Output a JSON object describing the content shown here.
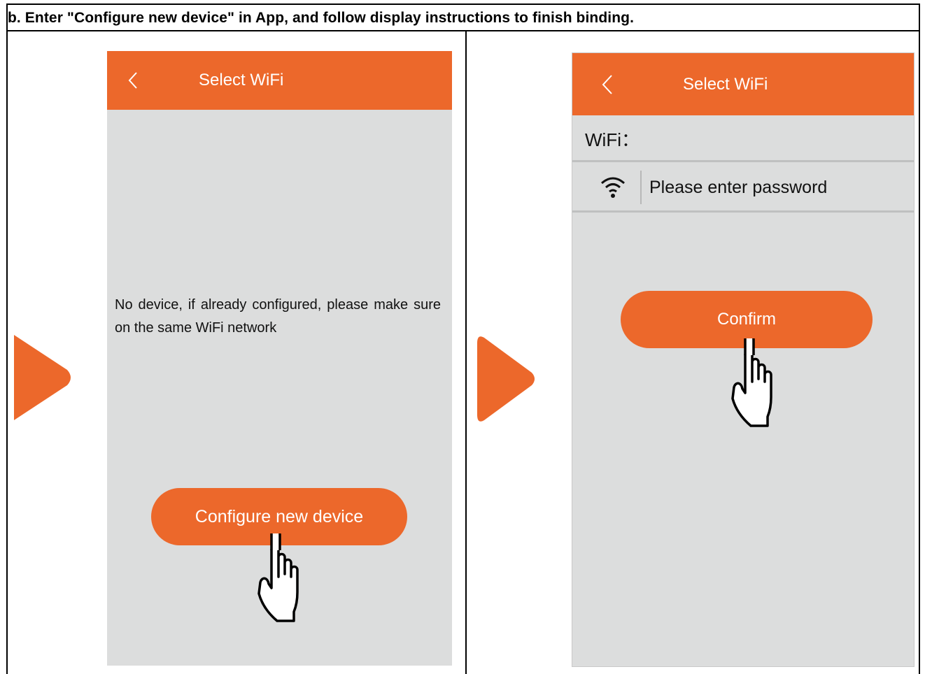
{
  "instruction": "b. Enter \"Configure new device\" in App, and follow display instructions to finish binding.",
  "colors": {
    "accent": "#ec682b",
    "screen_bg": "#dcdddd"
  },
  "screen1": {
    "back_icon": "chevron-left-icon",
    "title": "Select WiFi",
    "message": "No device, if already configured, please make sure on the same WiFi network",
    "configure_button": "Configure new device",
    "pointer_icon": "pointing-hand-icon"
  },
  "screen2": {
    "back_icon": "chevron-left-icon",
    "title": "Select WiFi",
    "wifi_label": "WiFi：",
    "wifi_icon": "wifi-icon",
    "password_placeholder": "Please enter password",
    "confirm_button": "Confirm",
    "pointer_icon": "pointing-hand-icon"
  },
  "step_arrow_icon": "play-arrow-icon"
}
